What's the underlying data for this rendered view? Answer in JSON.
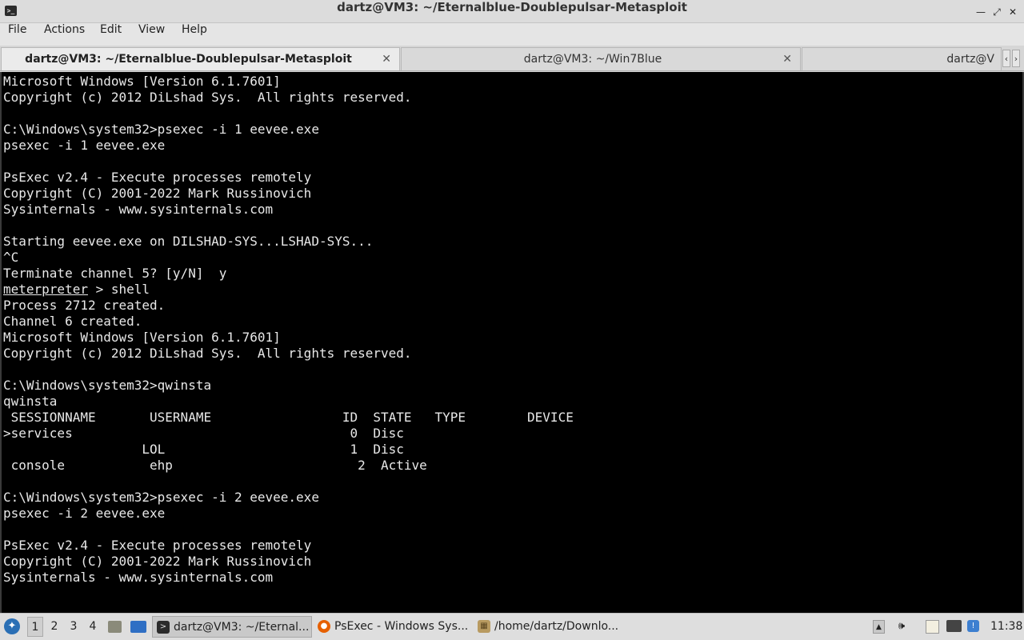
{
  "window": {
    "title": "dartz@VM3: ~/Eternalblue-Doublepulsar-Metasploit",
    "minimize_label": "—",
    "maximize_label": "⤢",
    "close_label": "✕"
  },
  "menu": {
    "file": "File",
    "actions": "Actions",
    "edit": "Edit",
    "view": "View",
    "help": "Help"
  },
  "tabs": [
    {
      "label": "dartz@VM3: ~/Eternalblue-Doublepulsar-Metasploit",
      "active": true
    },
    {
      "label": "dartz@VM3: ~/Win7Blue",
      "active": false
    },
    {
      "label": "dartz@V",
      "active": false
    }
  ],
  "tab_close_glyph": "✕",
  "tab_scroll": {
    "left": "‹",
    "right": "›"
  },
  "terminal": {
    "lines": [
      "Microsoft Windows [Version 6.1.7601]",
      "Copyright (c) 2012 DiLshad Sys.  All rights reserved.",
      "",
      "C:\\Windows\\system32>psexec -i 1 eevee.exe",
      "psexec -i 1 eevee.exe",
      "",
      "PsExec v2.4 - Execute processes remotely",
      "Copyright (C) 2001-2022 Mark Russinovich",
      "Sysinternals - www.sysinternals.com",
      "",
      "Starting eevee.exe on DILSHAD-SYS...LSHAD-SYS...",
      "^C",
      "Terminate channel 5? [y/N]  y",
      "meterpreter > shell",
      "Process 2712 created.",
      "Channel 6 created.",
      "Microsoft Windows [Version 6.1.7601]",
      "Copyright (c) 2012 DiLshad Sys.  All rights reserved.",
      "",
      "C:\\Windows\\system32>qwinsta",
      "qwinsta",
      " SESSIONNAME       USERNAME                 ID  STATE   TYPE        DEVICE",
      ">services                                    0  Disc",
      "                  LOL                        1  Disc",
      " console           ehp                        2  Active",
      "",
      "C:\\Windows\\system32>psexec -i 2 eevee.exe",
      "psexec -i 2 eevee.exe",
      "",
      "PsExec v2.4 - Execute processes remotely",
      "Copyright (C) 2001-2022 Mark Russinovich",
      "Sysinternals - www.sysinternals.com"
    ],
    "meterpreter_prompt": "meterpreter",
    "meterpreter_rest": " > shell"
  },
  "taskbar": {
    "workspaces": [
      "1",
      "2",
      "3",
      "4"
    ],
    "active_workspace": "1",
    "tasks": [
      {
        "label": "dartz@VM3: ~/Eternal...",
        "icon": "terminal-icon"
      },
      {
        "label": "PsExec - Windows Sys...",
        "icon": "firefox-icon"
      },
      {
        "label": "/home/dartz/Downlo...",
        "icon": "archive-icon"
      }
    ],
    "clock": "11:38"
  },
  "colors": {
    "terminal_bg": "#000000",
    "terminal_fg": "#e8e8e8",
    "start_button": "#2a6fb5",
    "firefox": "#e66000"
  }
}
